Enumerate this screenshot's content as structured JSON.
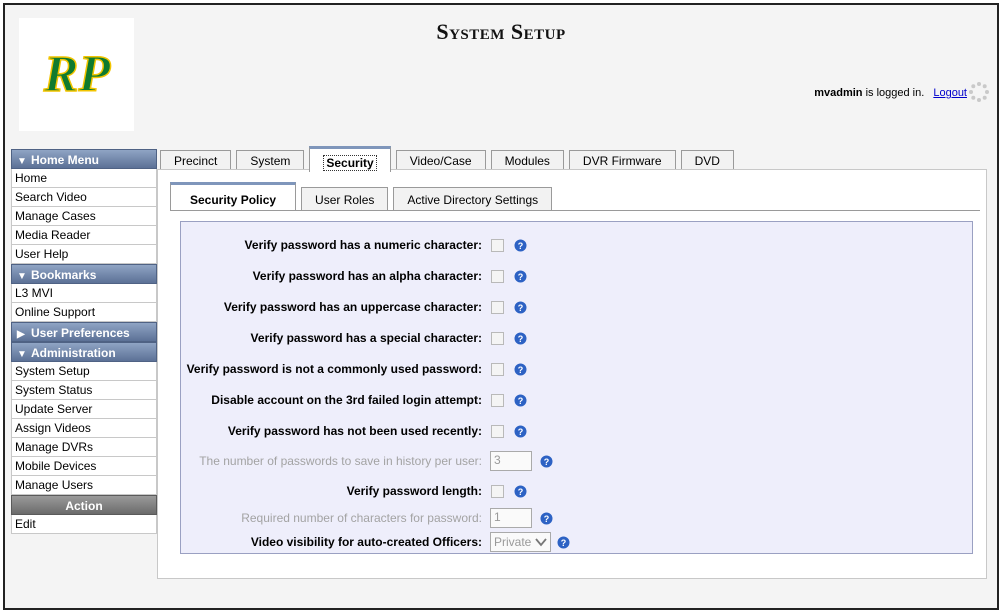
{
  "header": {
    "title": "System Setup",
    "logo_text": "RP",
    "username": "mvadmin",
    "logged_in_text": " is logged in.",
    "logout_label": "Logout"
  },
  "sidebar": {
    "home_menu": {
      "header": "Home Menu",
      "items": [
        "Home",
        "Search Video",
        "Manage Cases",
        "Media Reader",
        "User Help"
      ]
    },
    "bookmarks": {
      "header": "Bookmarks",
      "items": [
        "L3 MVI",
        "Online Support"
      ]
    },
    "user_preferences": {
      "header": "User Preferences"
    },
    "administration": {
      "header": "Administration",
      "items": [
        "System Setup",
        "System Status",
        "Update Server",
        "Assign Videos",
        "Manage DVRs",
        "Mobile Devices",
        "Manage Users"
      ]
    },
    "action": {
      "header": "Action",
      "items": [
        "Edit"
      ]
    }
  },
  "tabs": [
    "Precinct",
    "System",
    "Security",
    "Video/Case",
    "Modules",
    "DVR Firmware",
    "DVD"
  ],
  "active_tab": "Security",
  "sub_tabs": [
    "Security Policy",
    "User Roles",
    "Active Directory Settings"
  ],
  "active_sub_tab": "Security Policy",
  "form": {
    "numeric": "Verify password has a numeric character:",
    "alpha": "Verify password has an alpha character:",
    "uppercase": "Verify password has an uppercase character:",
    "special": "Verify password has a special character:",
    "common": "Verify password is not a commonly used password:",
    "disable": "Disable account on the 3rd failed login attempt:",
    "recent": "Verify password has not been used recently:",
    "history": {
      "label": "The number of passwords to save in history per user:",
      "value": "3"
    },
    "length": "Verify password length:",
    "required": {
      "label": "Required number of characters for password:",
      "value": "1"
    },
    "visibility": {
      "label": "Video visibility for auto-created Officers:",
      "value": "Private"
    }
  },
  "colors": {
    "accent_blue": "#5c7196",
    "form_bg": "#eeeefb",
    "link": "#0000cc"
  },
  "icons": [
    "logo-icon",
    "help-icon",
    "spinner-icon",
    "triangle-down-icon",
    "triangle-right-icon"
  ]
}
